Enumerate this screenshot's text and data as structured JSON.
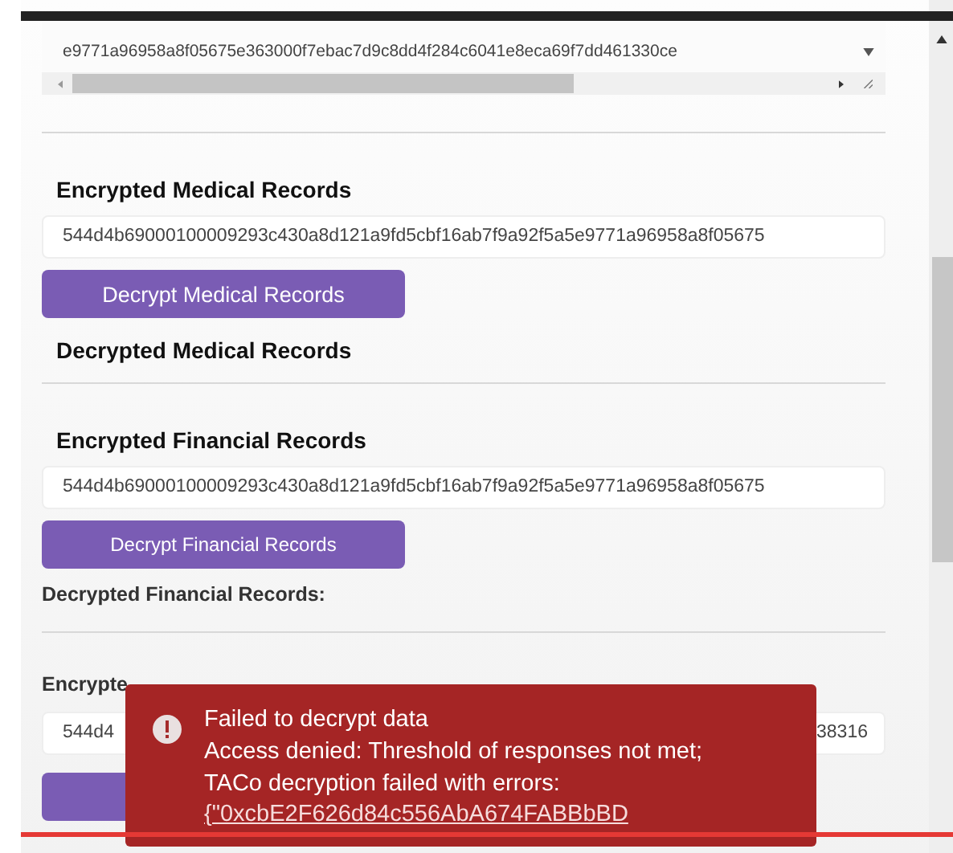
{
  "json_box": {
    "visible_line": "e9771a96958a8f05675e363000f7ebac7d9c8dd4f284c6041e8eca69f7dd461330ce"
  },
  "sections": [
    {
      "heading": "Encrypted Medical Records",
      "value": "544d4b69000100009293c430a8d121a9fd5cbf16ab7f9a92f5a5e9771a96958a8f05675",
      "button": "Decrypt Medical Records",
      "result": "Decrypted Medical Records",
      "kind": "large"
    },
    {
      "heading": "Encrypted Financial Records",
      "value": "544d4b69000100009293c430a8d121a9fd5cbf16ab7f9a92f5a5e9771a96958a8f05675",
      "button": "Decrypt Financial Records",
      "result": "Decrypted Financial Records:",
      "kind": "small"
    }
  ],
  "covered_section": {
    "heading": "Encrypte",
    "value_start": "544d4",
    "value_end": "38316"
  },
  "toast": {
    "title": "Failed to decrypt data",
    "lines": [
      "Access denied: Threshold of responses not met;",
      "TACo decryption failed with errors:"
    ],
    "detail": "{\"0xcbE2F626d84c556AbA674FABBbBD"
  }
}
